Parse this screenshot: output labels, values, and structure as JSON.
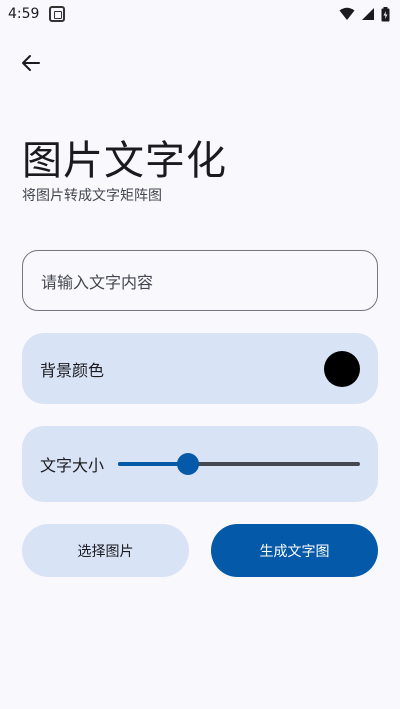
{
  "status_bar": {
    "time": "4:59",
    "icons": [
      "app-notification-icon",
      "wifi-icon",
      "signal-icon",
      "battery-icon"
    ]
  },
  "page": {
    "title": "图片文字化",
    "subtitle": "将图片转成文字矩阵图"
  },
  "text_input": {
    "placeholder": "请输入文字内容",
    "value": ""
  },
  "background_color": {
    "label": "背景颜色",
    "value": "#000000"
  },
  "text_size": {
    "label": "文字大小",
    "slider_fraction": 0.29
  },
  "buttons": {
    "select_image": "选择图片",
    "generate": "生成文字图"
  },
  "colors": {
    "primary": "#0459a8",
    "surface": "#f8f8fd",
    "container": "#d9e3f6"
  }
}
